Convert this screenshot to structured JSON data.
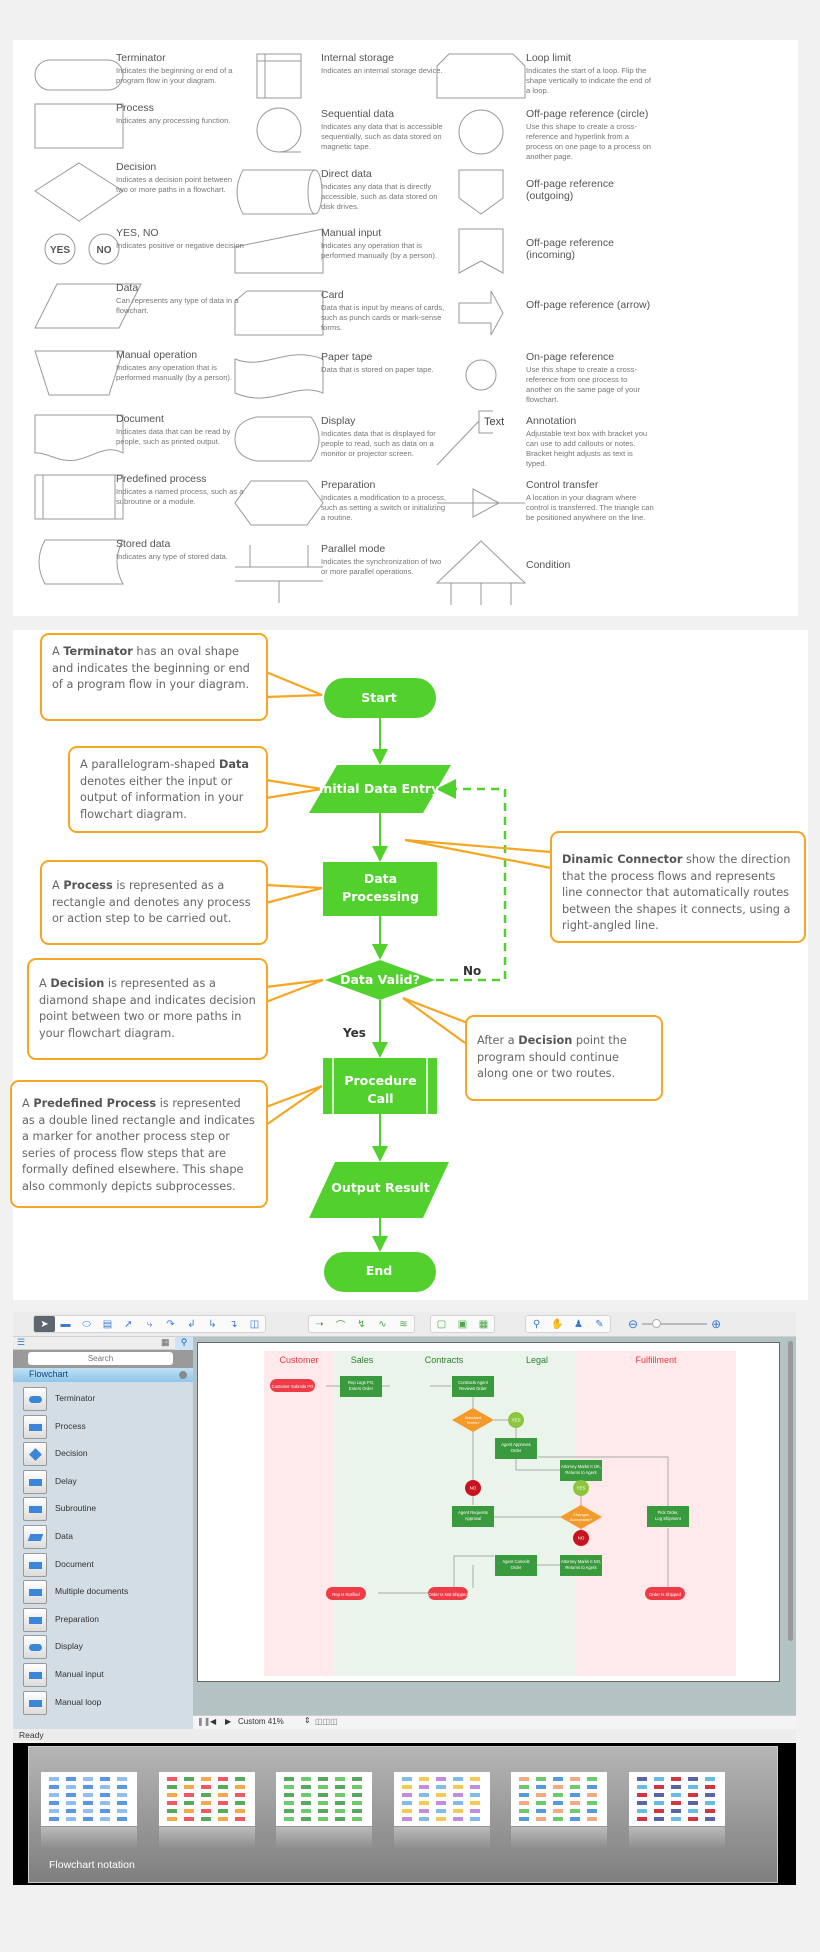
{
  "legend": {
    "items": [
      {
        "title": "Terminator",
        "desc": "Indicates the beginning or end of a program flow in your diagram.",
        "shape": "terminator"
      },
      {
        "title": "Process",
        "desc": "Indicates any processing function.",
        "shape": "process"
      },
      {
        "title": "Decision",
        "desc": "Indicates a decision point between two or more paths in a flowchart.",
        "shape": "decision"
      },
      {
        "title": "YES, NO",
        "desc": "Indicates positive or negative decision",
        "shape": "yes-no",
        "yes": "YES",
        "no": "NO"
      },
      {
        "title": "Data",
        "desc": "Can represents any type of data in a flowchart.",
        "shape": "data"
      },
      {
        "title": "Manual operation",
        "desc": "Indicates any operation that is performed manually (by a person).",
        "shape": "manual-operation"
      },
      {
        "title": "Document",
        "desc": "Indicates data that can be read by people, such as printed output.",
        "shape": "document"
      },
      {
        "title": "Predefined process",
        "desc": "Indicates a named process, such as a subroutine or a module.",
        "shape": "predefined-process"
      },
      {
        "title": "Stored data",
        "desc": "Indicates any type of stored data.",
        "shape": "stored-data"
      },
      {
        "title": "Internal storage",
        "desc": "Indicates an internal storage device.",
        "shape": "internal-storage"
      },
      {
        "title": "Sequential data",
        "desc": "Indicates any data that is accessible sequentially, such as data stored on magnetic tape.",
        "shape": "sequential-data"
      },
      {
        "title": "Direct data",
        "desc": "Indicates any data that is directly accessible, such as data stored on disk drives.",
        "shape": "direct-data"
      },
      {
        "title": "Manual input",
        "desc": "Indicates any operation that is performed manually (by a person).",
        "shape": "manual-input"
      },
      {
        "title": "Card",
        "desc": "Data that is input by means of cards, such as punch cards or mark-sense forms.",
        "shape": "card"
      },
      {
        "title": "Paper tape",
        "desc": "Data that is stored on paper tape.",
        "shape": "paper-tape"
      },
      {
        "title": "Display",
        "desc": "Indicates data that is displayed for people to read, such as data on a monitor or projector screen.",
        "shape": "display"
      },
      {
        "title": "Preparation",
        "desc": "Indicates a modification to a process, such as setting a switch or initializing a routine.",
        "shape": "preparation"
      },
      {
        "title": "Parallel mode",
        "desc": "Indicates the synchronization of two or more parallel operations.",
        "shape": "parallel-mode"
      },
      {
        "title": "Loop limit",
        "desc": "Indicates the start of a loop. Flip the shape vertically to indicate the end of a loop.",
        "shape": "loop-limit"
      },
      {
        "title": "Off-page reference (circle)",
        "desc": "Use this shape to create a cross-reference and hyperlink from a process on one page to a process on another page.",
        "shape": "off-page-circle"
      },
      {
        "title": "Off-page reference (outgoing)",
        "desc": "",
        "shape": "off-page-outgoing"
      },
      {
        "title": "Off-page reference (incoming)",
        "desc": "",
        "shape": "off-page-incoming"
      },
      {
        "title": "Off-page reference (arrow)",
        "desc": "",
        "shape": "off-page-arrow"
      },
      {
        "title": "On-page reference",
        "desc": "Use this shape to create a cross-reference from one process to another on the same page of your flowchart.",
        "shape": "on-page-reference"
      },
      {
        "title": "Annotation",
        "desc": "Adjustable text box with bracket you can use to add callouts or notes. Bracket height adjusts as text is typed.",
        "shape": "annotation",
        "shape_text": "Text"
      },
      {
        "title": "Control transfer",
        "desc": "A location in your diagram where control is transferred. The triangle can be positioned anywhere on the line.",
        "shape": "control-transfer"
      },
      {
        "title": "Condition",
        "desc": "",
        "shape": "condition"
      }
    ]
  },
  "annotated": {
    "colors": {
      "shape": "#52d12e",
      "callout_border": "#f5a623"
    },
    "nodes": {
      "start": "Start",
      "initial_data": "Initial Data Entry",
      "data_processing": "Data Processing",
      "data_valid": "Data Valid?",
      "procedure_call": "Procedure Call",
      "output_result": "Output Result",
      "end": "End"
    },
    "branch_yes": "Yes",
    "branch_no": "No",
    "callouts": {
      "terminator": {
        "pre": "A ",
        "bold": "Terminator",
        "post": " has an oval shape and indicates the beginning or end of a program flow in your diagram."
      },
      "data": {
        "pre": "A parallelogram-shaped ",
        "bold": "Data",
        "post": " denotes either the input or output of information in your flowchart diagram."
      },
      "process": {
        "pre": "A ",
        "bold": "Process",
        "post": " is represented as a rectangle and denotes any process or action step to be carried out."
      },
      "decision": {
        "pre": "A ",
        "bold": "Decision",
        "post": " is represented as a diamond shape and indicates decision point between two or more paths in your flowchart diagram."
      },
      "predefined": {
        "pre": "A ",
        "bold": "Predefined Process",
        "post": " is represented as a double lined rectangle and indicates a marker for another process step or series of process flow steps that are formally defined elsewhere. This shape also commonly depicts subprocesses."
      },
      "connector": {
        "pre": "",
        "bold": "Dinamic Connector",
        "post": " show the direction that the process flows and represents line connector that automatically routes between the shapes it connects, using a right-angled line."
      },
      "after_decision": {
        "pre": "After a ",
        "bold": "Decision",
        "post": " point the program should continue along one or two routes."
      }
    }
  },
  "app": {
    "toolbar": {
      "groups": [
        [
          "pointer-tool",
          "rectangle-tool",
          "ellipse-tool",
          "table-tool",
          "connector-tool",
          "curved-connector-tool",
          "smart-connector-tool",
          "round-connector-tool",
          "tree-connector-tool",
          "org-connector-tool",
          "insert-tool"
        ],
        [
          "line-tool",
          "arc-tool",
          "bezier-tool",
          "polyline-tool",
          "freehand-tool"
        ],
        [
          "snap-tool",
          "group-tool",
          "ungroup-tool"
        ],
        [
          "zoom-tool",
          "pan-tool",
          "stamp-tool",
          "eyedropper-tool"
        ]
      ],
      "zoom_level": 0.15
    },
    "sidebar": {
      "search_placeholder": "Search",
      "section_title": "Flowchart",
      "items": [
        "Terminator",
        "Process",
        "Decision",
        "Delay",
        "Subroutine",
        "Data",
        "Document",
        "Multiple documents",
        "Preparation",
        "Display",
        "Manual input",
        "Manual loop"
      ]
    },
    "canvas": {
      "zoom_label": "Custom 41%",
      "lanes": [
        {
          "name": "Customer",
          "color": "#e8393f"
        },
        {
          "name": "Sales",
          "color": "#2e7d32"
        },
        {
          "name": "Contracts",
          "color": "#2e7d32"
        },
        {
          "name": "Legal",
          "color": "#2e7d32"
        },
        {
          "name": "Fulfillment",
          "color": "#e8393f"
        }
      ],
      "nodes": {
        "customer_submits": "Customer Submits PO",
        "rep_logs": "Rep Logs PO, Enters Order",
        "contracts_agent": "Contracts Agent Reviews Order",
        "standard_terms": "Standard Terms?",
        "yes1": "YES",
        "no1": "NO",
        "agent_approves": "Agent Approves Order",
        "attorney_ok": "Attorney Marks It OK, Returns to Agent",
        "yes2": "YES",
        "agent_requests": "Agent Requests Approval",
        "changes_acceptable": "Changes Acceptable?",
        "no2": "NO",
        "attorney_no": "Attorney Marks It NO, Returns to Agent",
        "agent_cancels": "Agent Cancels Order",
        "pick_order": "Pick Order, Log Shipment",
        "rep_notified": "Rep Is Notified",
        "not_shipped": "Order Is Not Shipped",
        "shipped": "Order Is Shipped"
      }
    },
    "status": "Ready",
    "browser_title": "Flowchart notation"
  }
}
